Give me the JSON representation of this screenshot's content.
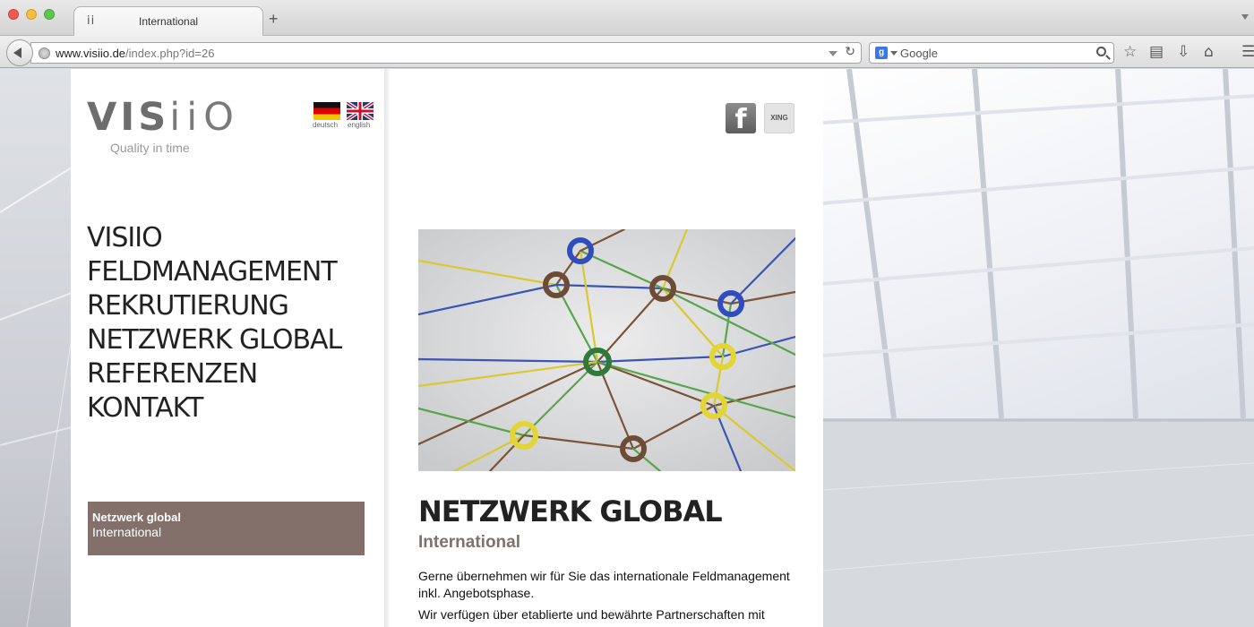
{
  "browser": {
    "tab_favicon": "ii",
    "tab_title": "International",
    "new_tab_label": "+",
    "url_host": "www.visiio.de",
    "url_path": "/index.php?id=26",
    "search_engine_icon": "g",
    "search_placeholder": "Google",
    "icons": [
      "globe-icon",
      "reload-icon",
      "search-icon",
      "star-icon",
      "reading-list-icon",
      "download-icon",
      "home-icon",
      "menu-icon"
    ]
  },
  "site": {
    "logo_text_bold": "VIS",
    "logo_text_thin": "iiO",
    "logo_tagline": "Quality in time",
    "languages": [
      {
        "label": "deutsch",
        "flag": "de"
      },
      {
        "label": "english",
        "flag": "gb"
      }
    ],
    "main_nav": [
      {
        "label": "VISIIO"
      },
      {
        "label": "FELDMANAGEMENT"
      },
      {
        "label": "REKRUTIERUNG"
      },
      {
        "label": "NETZWERK GLOBAL"
      },
      {
        "label": "REFERENZEN"
      },
      {
        "label": "KONTAKT"
      }
    ],
    "sub_nav": {
      "title": "Netzwerk global",
      "items": [
        "International"
      ]
    },
    "social": {
      "facebook_glyph": "f",
      "xing_label": "XING"
    },
    "colors": {
      "accent": "#84706a",
      "text": "#222222"
    }
  },
  "content": {
    "title": "NETZWERK GLOBAL",
    "subtitle": "International",
    "paragraphs": [
      "Gerne übernehmen wir für Sie das internationale Feldmanagement inkl. Angebotsphase.",
      "Wir verfügen über etablierte und bewährte Partnerschaften mit"
    ]
  }
}
